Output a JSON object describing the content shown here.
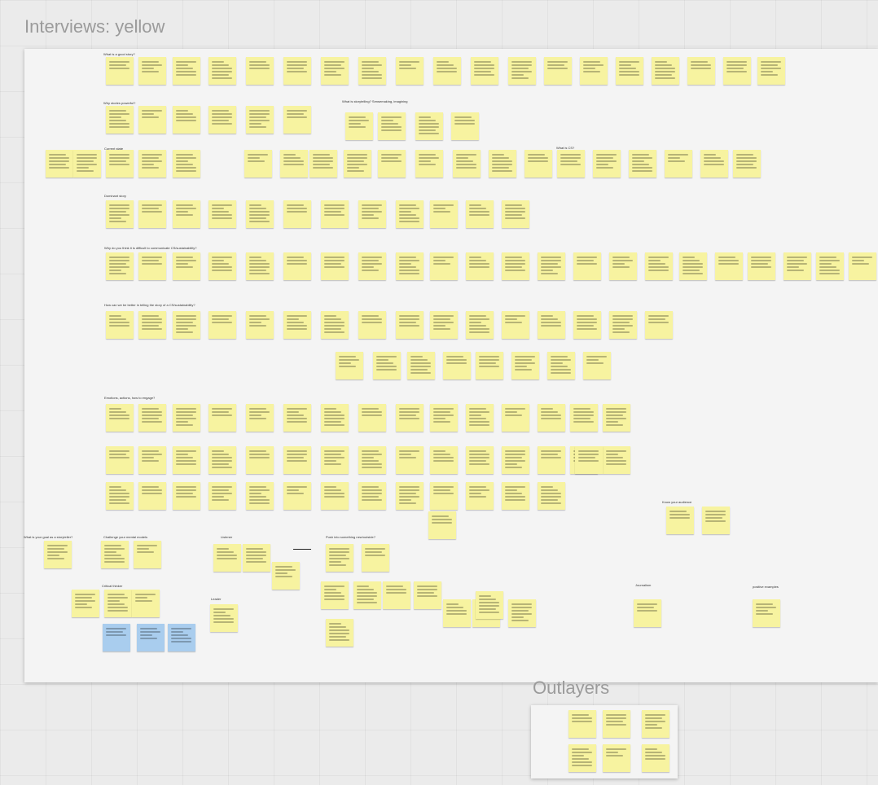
{
  "board": {
    "frame_title": "Interviews: yellow",
    "outlayers_title": "Outlayers"
  },
  "note_colors": {
    "yellow": "#f7f3a0",
    "dark_yellow": "#f2cb45",
    "blue": "#a9cdee"
  },
  "sections": [
    {
      "id": "good-story",
      "label": "What is a good story?"
    },
    {
      "id": "stories-powerful",
      "label": "Why stories powerful?"
    },
    {
      "id": "storytelling",
      "label": "What is storytelling? Sensemaking, imagining"
    },
    {
      "id": "current-state",
      "label": "Current state"
    },
    {
      "id": "cs",
      "label": "What is CS?"
    },
    {
      "id": "dominant-story",
      "label": "Dominant story"
    },
    {
      "id": "difficult",
      "label": "Why do you think it is difficult to communicate CS/sustainability?"
    },
    {
      "id": "better",
      "label": "How can we be better in telling the story of a CS/sustainability?"
    },
    {
      "id": "emotions",
      "label": "Emotions, actions, how to engage?"
    },
    {
      "id": "audience",
      "label": "Know your audience"
    },
    {
      "id": "goal",
      "label": "What is your goal as a storyteller?"
    },
    {
      "id": "mental-models",
      "label": "Challenge your mental models"
    },
    {
      "id": "listener",
      "label": "Listener"
    },
    {
      "id": "push",
      "label": "Push into something new/outside?"
    },
    {
      "id": "critical-thinker",
      "label": "Critical thinker"
    },
    {
      "id": "leader",
      "label": "Leader"
    },
    {
      "id": "journalism",
      "label": "Journalism"
    },
    {
      "id": "positive-examples",
      "label": "positive examples"
    }
  ]
}
